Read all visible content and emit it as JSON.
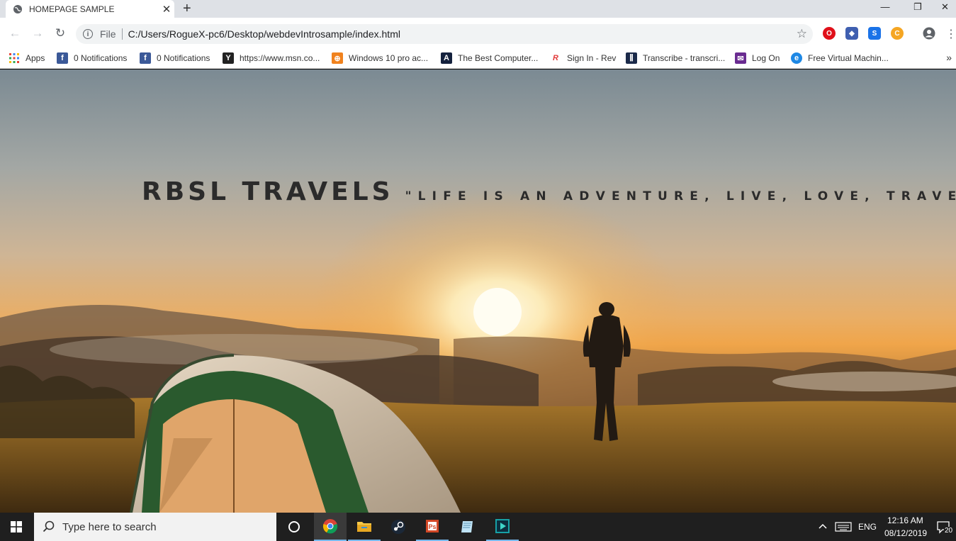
{
  "browser": {
    "tab": {
      "title": "HOMEPAGE SAMPLE",
      "close_glyph": "✕"
    },
    "new_tab_glyph": "+",
    "window_controls": {
      "minimize": "—",
      "maximize": "❐",
      "close": "✕"
    },
    "toolbar": {
      "back_glyph": "←",
      "forward_glyph": "→",
      "reload_glyph": "↻",
      "scheme_label": "File",
      "url": "C:/Users/RogueX-pc6/Desktop/webdevIntrosample/index.html",
      "info_glyph": "i",
      "star_glyph": "☆",
      "menu_glyph": "⋮"
    },
    "bookmarks": [
      {
        "label": "Apps",
        "icon": "apps-grid-icon",
        "color": "#ffffff"
      },
      {
        "label": "0 Notifications",
        "icon": "facebook-icon",
        "color": "#3b5998"
      },
      {
        "label": "0 Notifications",
        "icon": "facebook-icon",
        "color": "#3b5998"
      },
      {
        "label": "https://www.msn.co...",
        "icon": "msn-icon",
        "color": "#222222"
      },
      {
        "label": "Windows 10 pro ac...",
        "icon": "windows-key-icon",
        "color": "#f0821e"
      },
      {
        "label": "The Best Computer...",
        "icon": "a-logo-icon",
        "color": "#14213d"
      },
      {
        "label": "Sign In - Rev",
        "icon": "rev-icon",
        "color": "#e23a3a"
      },
      {
        "label": "Transcribe - transcri...",
        "icon": "transcribe-icon",
        "color": "#1b2a4a"
      },
      {
        "label": "Log On",
        "icon": "mail-icon",
        "color": "#6a2c91"
      },
      {
        "label": "Free Virtual Machin...",
        "icon": "edge-icon",
        "color": "#1e88e5"
      }
    ],
    "more_bookmarks_glyph": "»"
  },
  "page": {
    "brand": "RBSL TRAVELS",
    "tagline": "\"LIFE IS AN ADVENTURE, LIVE, LOVE, TRAVEL, EXPLORE\""
  },
  "taskbar": {
    "search_placeholder": "Type here to search",
    "apps": [
      "cortana-icon",
      "chrome-icon",
      "file-explorer-icon",
      "steam-icon",
      "powerpoint-icon",
      "notepad-icon",
      "media-player-icon"
    ],
    "language": "ENG",
    "time": "12:16 AM",
    "date": "08/12/2019",
    "notification_count": "20"
  }
}
